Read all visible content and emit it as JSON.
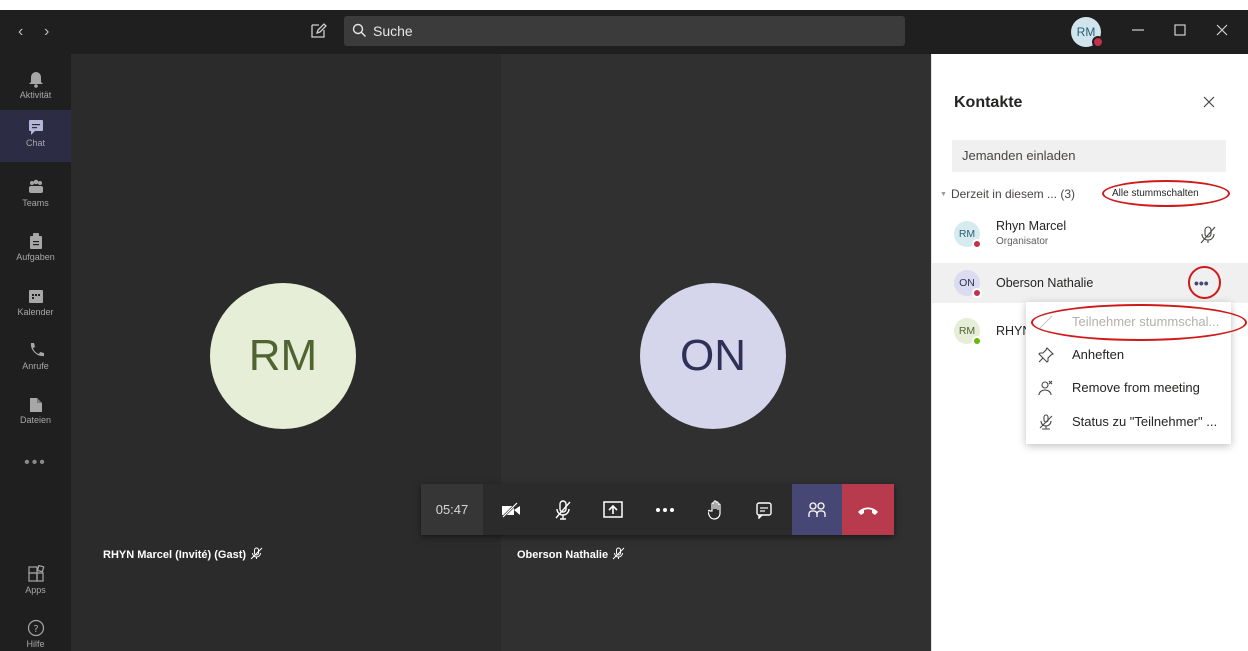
{
  "topbar": {
    "search_placeholder": "Suche",
    "user_initials": "RM"
  },
  "rail": {
    "items": [
      {
        "label": "Aktivität",
        "icon": "bell-icon"
      },
      {
        "label": "Chat",
        "icon": "chat-icon"
      },
      {
        "label": "Teams",
        "icon": "teams-icon"
      },
      {
        "label": "Aufgaben",
        "icon": "tasks-icon"
      },
      {
        "label": "Kalender",
        "icon": "calendar-icon"
      },
      {
        "label": "Anrufe",
        "icon": "phone-icon"
      },
      {
        "label": "Dateien",
        "icon": "files-icon"
      }
    ],
    "more": "•••",
    "apps": "Apps",
    "help": "Hilfe"
  },
  "stage": {
    "left": {
      "initials": "RM",
      "name": "RHYN Marcel (Invité) (Gast)"
    },
    "right": {
      "initials": "ON",
      "name": "Oberson Nathalie"
    }
  },
  "controls": {
    "timer": "05:47",
    "icons": [
      "video-off-icon",
      "mic-off-icon",
      "share-icon",
      "more-icon",
      "raise-hand-icon",
      "chat-icon",
      "participants-icon",
      "hangup-icon"
    ]
  },
  "panel": {
    "title": "Kontakte",
    "invite_placeholder": "Jemanden einladen",
    "section_label": "Derzeit in diesem ...",
    "section_count": "(3)",
    "mute_all": "Alle stummschalten",
    "people": [
      {
        "initials": "RM",
        "name": "Rhyn Marcel",
        "role": "Organisator",
        "status": "busy"
      },
      {
        "initials": "ON",
        "name": "Oberson Nathalie",
        "role": "",
        "status": "busy"
      },
      {
        "initials": "RM",
        "name": "RHYN",
        "role": "",
        "status": "available"
      }
    ]
  },
  "menu": {
    "items": [
      {
        "label": "Teilnehmer stummschal...",
        "icon": "mic-off-icon",
        "disabled": true
      },
      {
        "label": "Anheften",
        "icon": "pin-icon",
        "disabled": false
      },
      {
        "label": "Remove from meeting",
        "icon": "remove-person-icon",
        "disabled": false
      },
      {
        "label": "Status zu \"Teilnehmer\" ...",
        "icon": "make-attendee-icon",
        "disabled": false
      }
    ]
  },
  "colors": {
    "accent": "#464775",
    "hangup": "#b83a4d",
    "callout": "#d01919",
    "busy": "#c4314b",
    "available": "#6bb700"
  }
}
